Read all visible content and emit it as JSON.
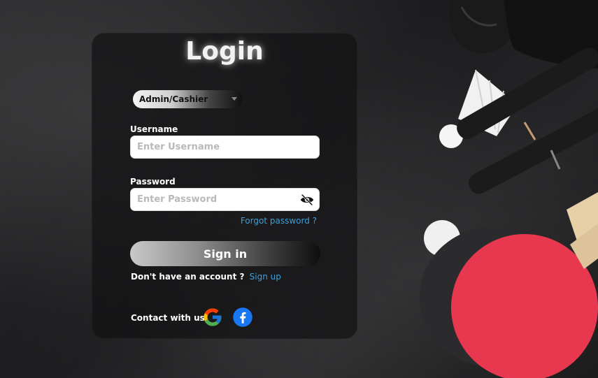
{
  "login": {
    "title": "Login",
    "role_selected": "Admin/Cashier",
    "username_label": "Username",
    "username_placeholder": "Enter Username",
    "password_label": "Password",
    "password_placeholder": "Enter Password",
    "forgot_label": "Forgot password ?",
    "signin_label": "Sign in",
    "no_account_text": "Don't have an account ?",
    "signup_label": "Sign up",
    "contact_text": "Contact with us"
  },
  "icons": {
    "password_toggle": "eye-off-icon",
    "google": "google-icon",
    "facebook": "facebook-icon"
  },
  "colors": {
    "link": "#3ea0dd",
    "paddle_red": "#e8384f",
    "facebook": "#1877f2"
  }
}
